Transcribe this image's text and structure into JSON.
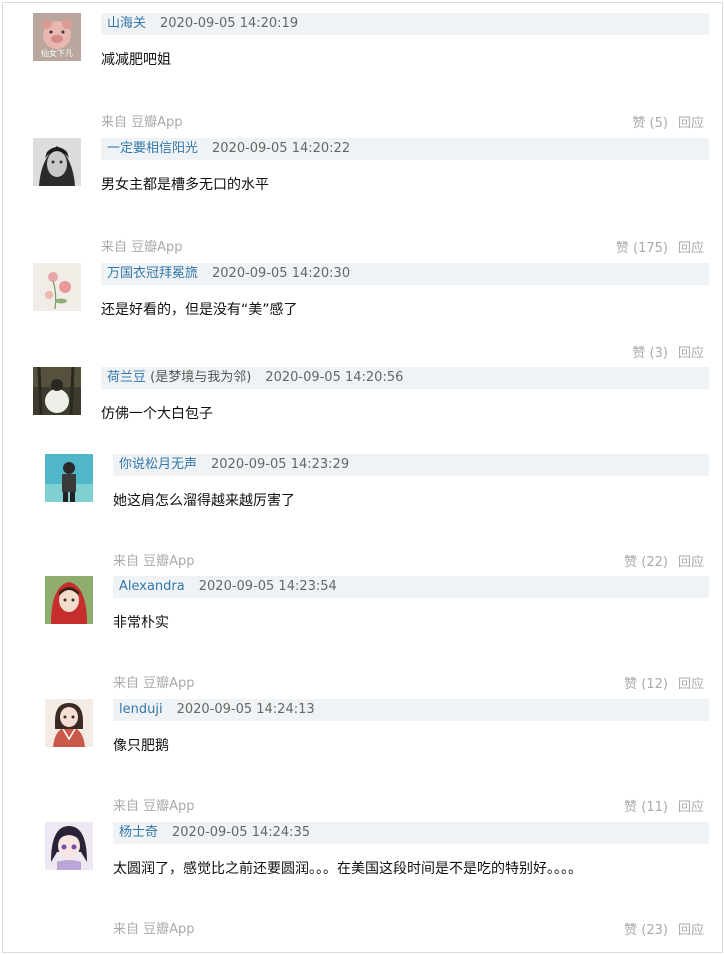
{
  "comments": [
    {
      "avatar": "avatar-pig-icon",
      "avatar_text": "仙女下凡",
      "user": "山海关",
      "time": "2020-09-05 14:20:19",
      "text": "减减肥吧姐",
      "source": "来自 豆瓣App",
      "like": "赞 (5)",
      "reply": "回应"
    },
    {
      "avatar": "avatar-boy-icon",
      "user": "一定要相信阳光",
      "time": "2020-09-05 14:20:22",
      "text": "男女主都是槽多无口的水平",
      "source": "来自 豆瓣App",
      "like": "赞 (175)",
      "reply": "回应"
    },
    {
      "avatar": "avatar-flowers-icon",
      "user": "万国衣冠拜冕旒",
      "time": "2020-09-05 14:20:30",
      "text": "还是好看的，但是没有“美”感了",
      "like": "赞 (3)",
      "reply": "回应"
    },
    {
      "avatar": "avatar-woods-icon",
      "user": "荷兰豆",
      "user_sub": " (是梦境与我为邻)",
      "time": "2020-09-05 14:20:56",
      "text": "仿佛一个大白包子"
    }
  ],
  "replies": [
    {
      "avatar": "avatar-figure-icon",
      "user": "你说松月无声",
      "time": "2020-09-05 14:23:29",
      "text": "她这肩怎么溜得越来越厉害了",
      "source": "来自 豆瓣App",
      "like": "赞 (22)",
      "reply": "回应"
    },
    {
      "avatar": "avatar-red-hood-icon",
      "user": "Alexandra",
      "time": "2020-09-05 14:23:54",
      "text": "非常朴实",
      "source": "来自 豆瓣App",
      "like": "赞 (12)",
      "reply": "回应"
    },
    {
      "avatar": "avatar-kimono-icon",
      "user": "lenduji",
      "time": "2020-09-05 14:24:13",
      "text": "像只肥鹅",
      "source": "来自 豆瓣App",
      "like": "赞 (11)",
      "reply": "回应"
    },
    {
      "avatar": "avatar-anime-icon",
      "user": "杨士奇",
      "time": "2020-09-05 14:24:35",
      "text": "太圆润了，感觉比之前还要圆润。。。在美国这段时间是不是吃的特别好。。。。",
      "source": "来自 豆瓣App",
      "like": "赞 (23)",
      "reply": "回应"
    }
  ]
}
